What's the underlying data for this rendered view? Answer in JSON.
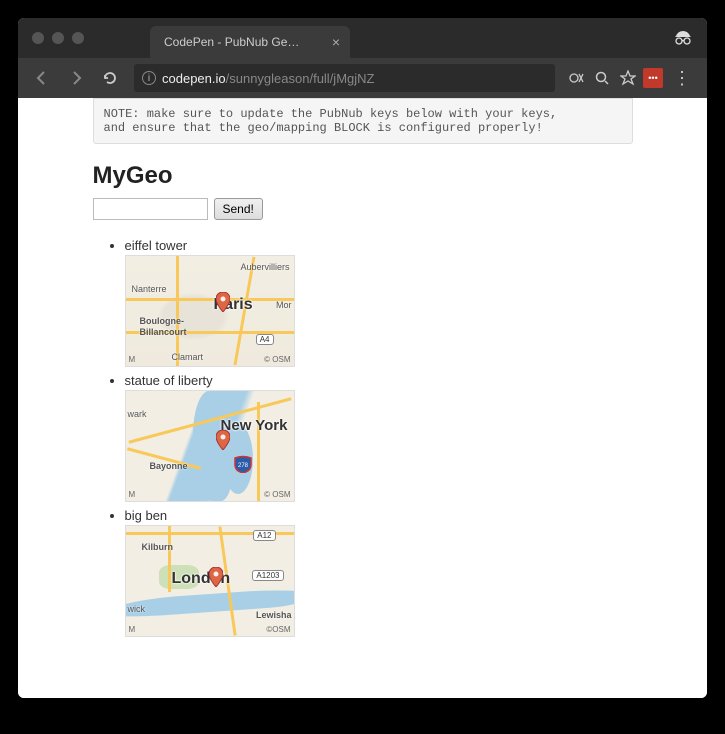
{
  "browser": {
    "tab_title": "CodePen - PubNub Geocoding",
    "url_host": "codepen.io",
    "url_path": "/sunnygleason/full/jMgjNZ",
    "ext_label": "•••"
  },
  "page": {
    "note": "NOTE: make sure to update the PubNub keys below with your keys,\nand ensure that the geo/mapping BLOCK is configured properly!",
    "title": "MyGeo",
    "input_value": "",
    "send_label": "Send!",
    "results": [
      {
        "label": "eiffel tower",
        "city": "Paris",
        "labels": [
          "Nanterre",
          "Aubervilliers",
          "Boulogne-",
          "Billancourt",
          "Clamart",
          "Mor"
        ],
        "shields": [
          "A4"
        ],
        "attribution_left": "M",
        "attribution_right": "© OSM"
      },
      {
        "label": "statue of liberty",
        "city": "New York",
        "labels": [
          "wark",
          "Bayonne"
        ],
        "shields": [
          "278"
        ],
        "attribution_left": "M",
        "attribution_right": "© OSM"
      },
      {
        "label": "big ben",
        "city": "London",
        "labels": [
          "Kilburn",
          "wick",
          "Lewisha"
        ],
        "shields": [
          "A12",
          "A1203"
        ],
        "attribution_left": "M",
        "attribution_right": "©OSM"
      }
    ]
  }
}
